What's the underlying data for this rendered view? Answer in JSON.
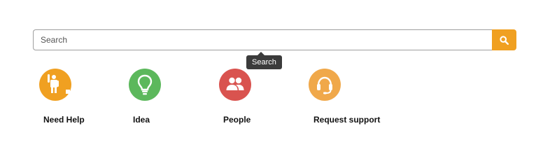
{
  "search": {
    "placeholder": "Search",
    "tooltip": "Search",
    "button_icon": "search-icon"
  },
  "quick_links": [
    {
      "label": "Need Help",
      "icon": "raised-hand-person-icon",
      "color": "#f0a021"
    },
    {
      "label": "Idea",
      "icon": "lightbulb-icon",
      "color": "#5cb85c"
    },
    {
      "label": "People",
      "icon": "people-icon",
      "color": "#d9534f"
    },
    {
      "label": "Request support",
      "icon": "headset-icon",
      "color": "#f0a84a"
    }
  ]
}
